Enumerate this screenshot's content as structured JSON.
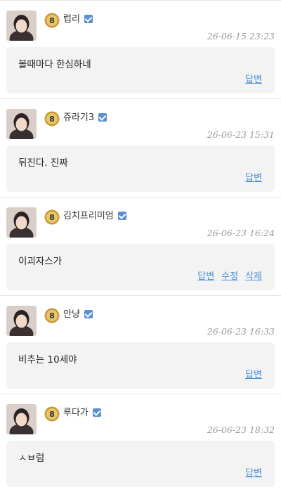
{
  "comments": [
    {
      "username": "럽리",
      "level": "8",
      "timestamp": "26-06-15 23:23",
      "text": "볼때마다 한심하네",
      "actions": [
        "답변"
      ]
    },
    {
      "username": "쥬라기3",
      "level": "8",
      "timestamp": "26-06-23 15:31",
      "text": "뒤진다. 진짜",
      "actions": [
        "답변"
      ]
    },
    {
      "username": "김치프리미엄",
      "level": "8",
      "timestamp": "26-06-23 16:24",
      "text": "이괴자스가",
      "actions": [
        "답변",
        "수정",
        "삭제"
      ]
    },
    {
      "username": "안냥",
      "level": "8",
      "timestamp": "26-06-23 16:33",
      "text": "비추는 10세야",
      "actions": [
        "답변"
      ]
    },
    {
      "username": "루다가",
      "level": "8",
      "timestamp": "26-06-23 18:32",
      "text": "ㅅㅂ럼",
      "actions": [
        "답변"
      ]
    }
  ],
  "colors": {
    "accent": "#4a8fd6",
    "bubble": "#f3f3f3",
    "badge": "#5b8fd1",
    "level_gold": "#d9b04a"
  },
  "icons": {
    "verified": "verified-check-icon",
    "level": "level-medal-icon"
  }
}
